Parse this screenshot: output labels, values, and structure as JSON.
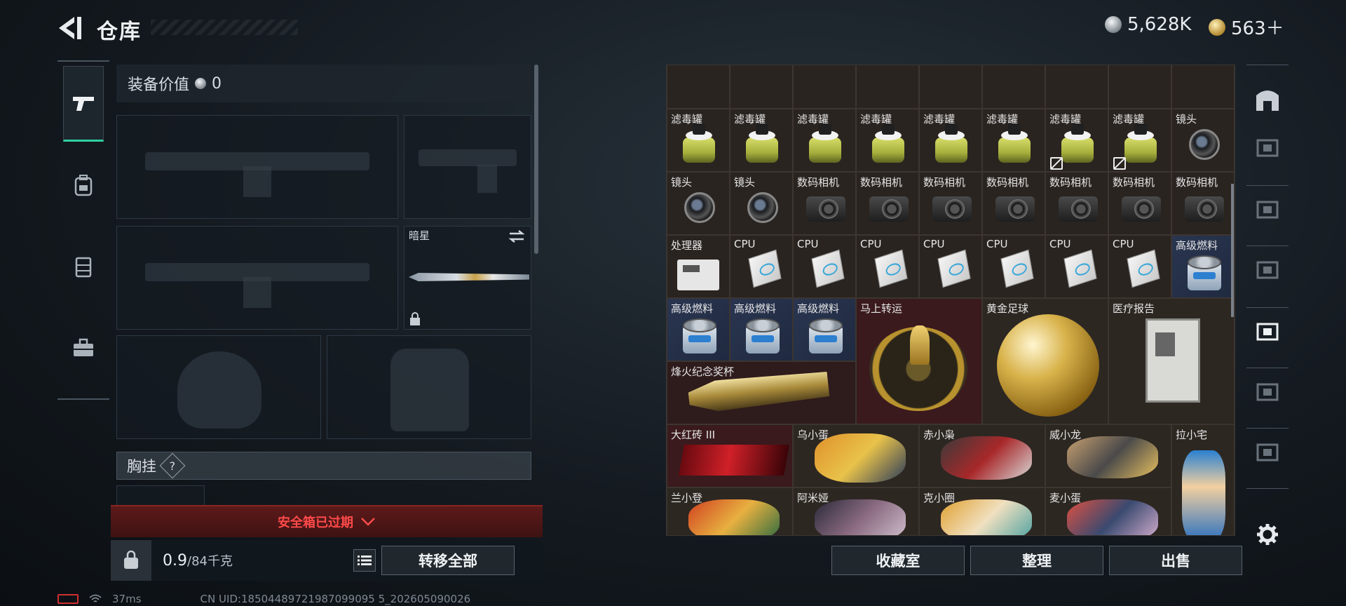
{
  "header": {
    "title": "仓库",
    "currency_silver": "5,628K",
    "currency_gold": "563＋"
  },
  "equipment": {
    "value_label": "装备价值",
    "value_amount": "0",
    "secondary_weapon_name": "暗星",
    "chest_rig_label": "胸挂",
    "chest_rig_help": "?",
    "safebox_status": "安全箱已过期",
    "weight_current": "0.9",
    "weight_max": "/84千克",
    "transfer_all_label": "转移全部"
  },
  "grid_items": {
    "row0": [
      "",
      "",
      "",
      "",
      "",
      "",
      "",
      "",
      ""
    ],
    "row1": [
      "滤毒罐",
      "滤毒罐",
      "滤毒罐",
      "滤毒罐",
      "滤毒罐",
      "滤毒罐",
      "滤毒罐",
      "滤毒罐",
      "镜头"
    ],
    "row2": [
      "镜头",
      "镜头",
      "数码相机",
      "数码相机",
      "数码相机",
      "数码相机",
      "数码相机",
      "数码相机",
      "数码相机"
    ],
    "row3": [
      "处理器",
      "CPU",
      "CPU",
      "CPU",
      "CPU",
      "CPU",
      "CPU",
      "CPU",
      "高级燃料"
    ],
    "row4_small": [
      "高级燃料",
      "高级燃料",
      "高级燃料"
    ],
    "large": {
      "mashang": "马上转运",
      "football": "黄金足球",
      "report": "医疗报告",
      "trophy": "烽火纪念奖杯",
      "brick": "大红砖 III",
      "wu": "乌小蛋",
      "chi": "赤小枭",
      "wei": "威小龙",
      "la": "拉小宅",
      "lan": "兰小登",
      "ami": "阿米娅",
      "ke": "克小圈",
      "mai": "麦小蛋"
    }
  },
  "actions": {
    "collection": "收藏室",
    "organize": "整理",
    "sell": "出售"
  },
  "status": {
    "ping": "37ms",
    "uid": "CN UID:18504489721987099095 5_202605090026"
  },
  "colors": {
    "accent": "#2fd0a0",
    "danger": "#ff4a4a",
    "panel": "#2a2420"
  }
}
